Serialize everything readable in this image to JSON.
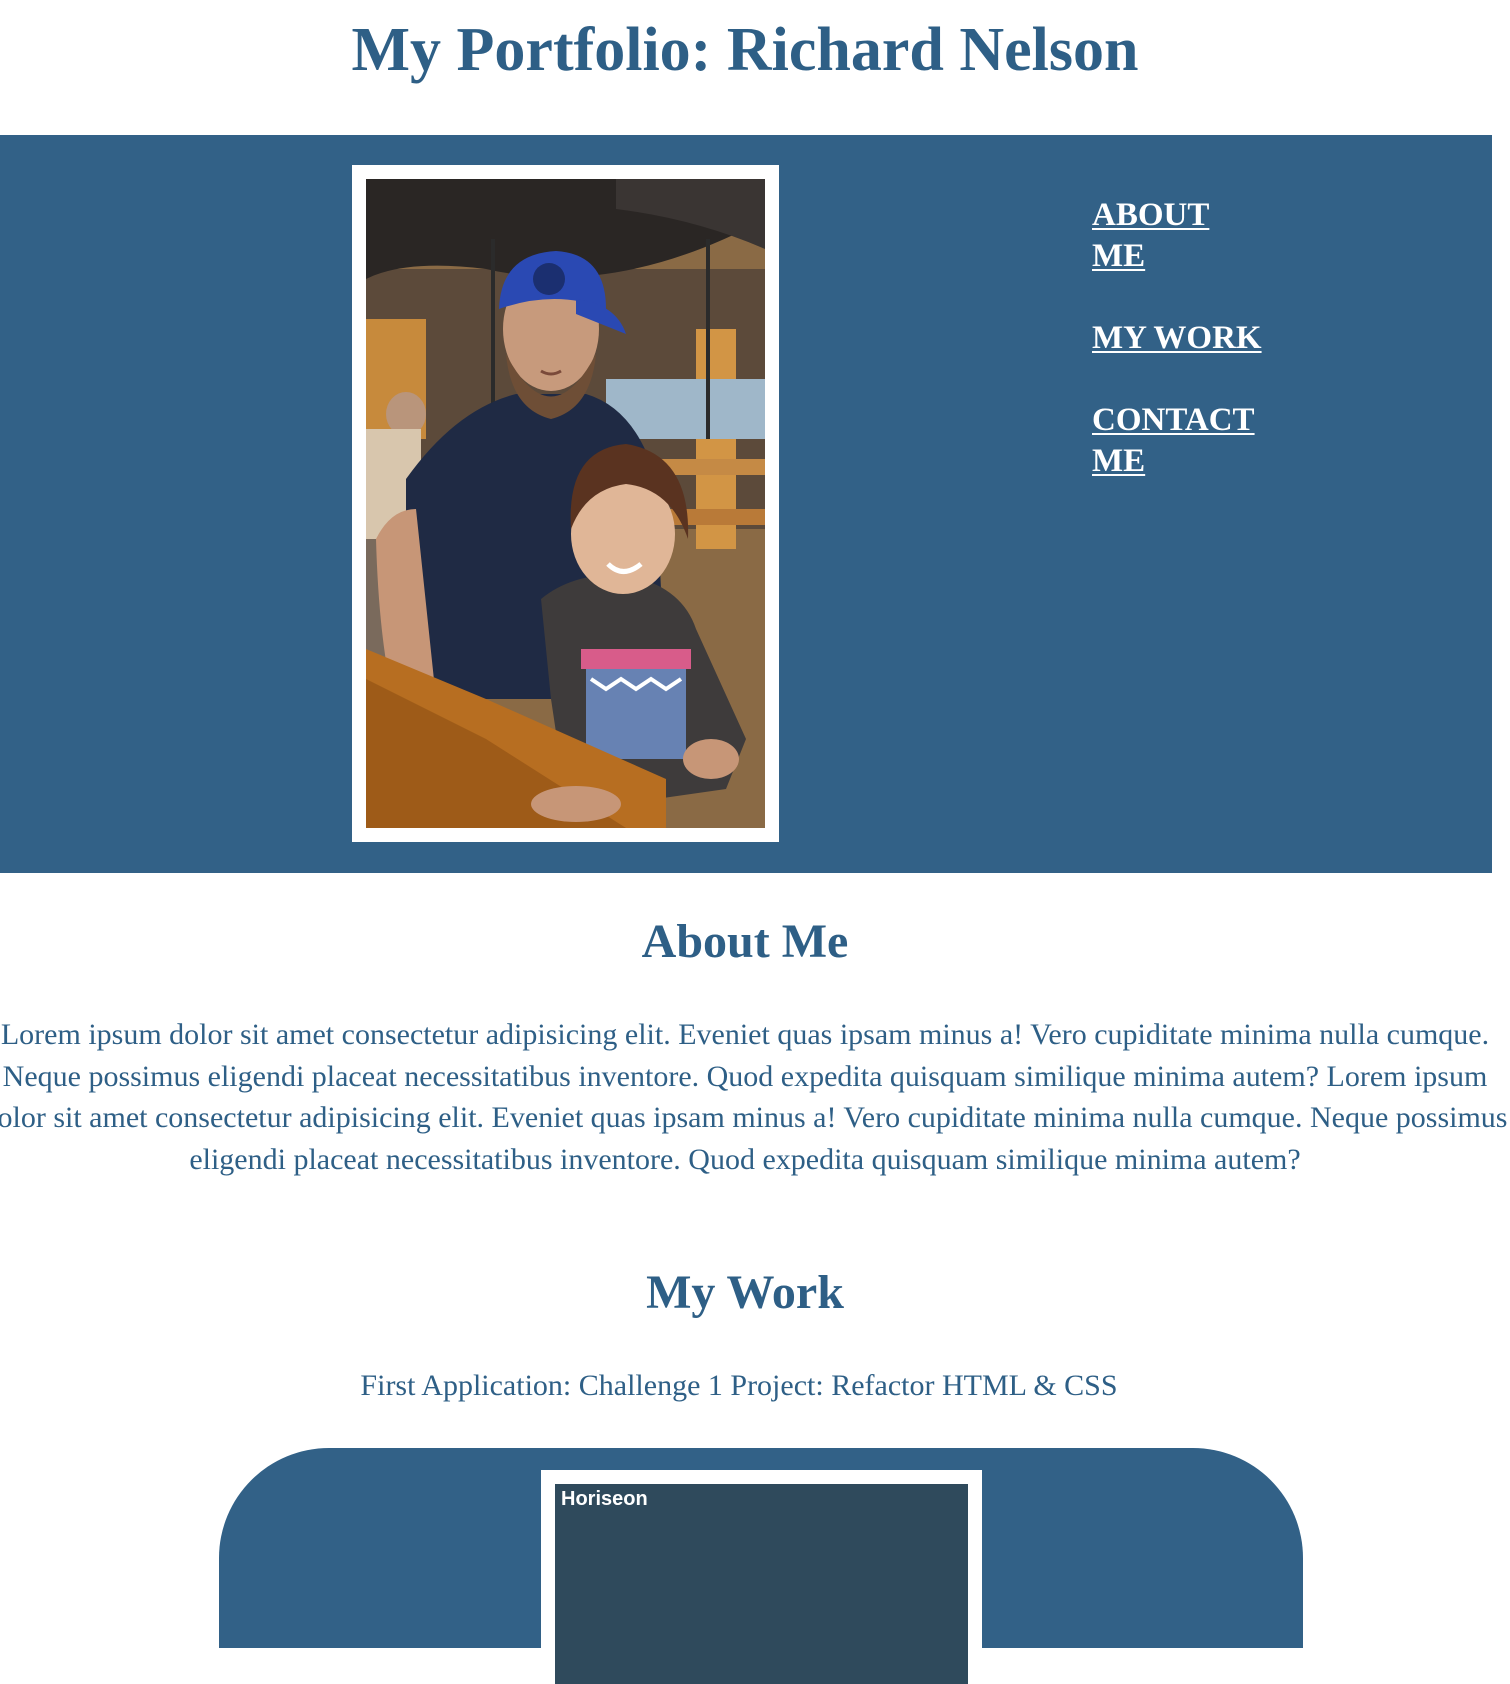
{
  "page": {
    "title": "My Portfolio: Richard Nelson"
  },
  "nav": {
    "items": [
      {
        "label": "ABOUT ME"
      },
      {
        "label": "MY WORK"
      },
      {
        "label": "CONTACT ME"
      }
    ]
  },
  "hero": {
    "photo_alt": "Richard Nelson with child"
  },
  "about": {
    "heading": "About Me",
    "text": "Lorem ipsum dolor sit amet consectetur adipisicing elit. Eveniet quas ipsam minus a! Vero cupiditate minima nulla cumque. Neque possimus eligendi placeat necessitatibus inventore. Quod expedita quisquam similique minima autem? Lorem ipsum dolor sit amet consectetur adipisicing elit. Eveniet quas ipsam minus a! Vero cupiditate minima nulla cumque. Neque possimus eligendi placeat necessitatibus inventore. Quod expedita quisquam similique minima autem?"
  },
  "work": {
    "heading": "My Work",
    "first_item": "First Application: Challenge 1 Project: Refactor HTML & CSS",
    "project_screenshot_brand": "Horiseon"
  },
  "colors": {
    "brand": "#326187",
    "heading_text": "#2e5f86",
    "background": "#ffffff"
  }
}
